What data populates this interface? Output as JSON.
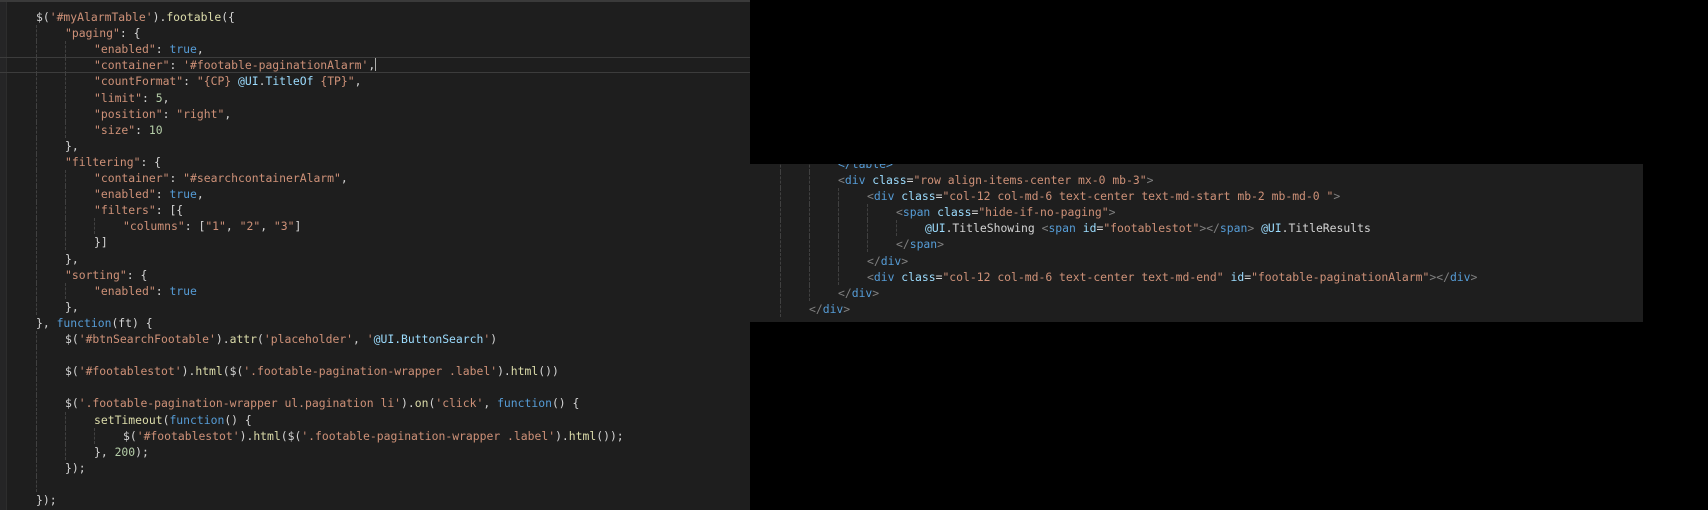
{
  "editor_left": {
    "language": "javascript",
    "lines": [
      {
        "indent": 0,
        "tokens": [
          [
            "plain",
            "$("
          ],
          [
            "string",
            "'#myAlarmTable'"
          ],
          [
            "plain",
            ")."
          ],
          [
            "method",
            "footable"
          ],
          [
            "plain",
            "({"
          ]
        ]
      },
      {
        "indent": 1,
        "tokens": [
          [
            "string",
            "\"paging\""
          ],
          [
            "plain",
            ": {"
          ]
        ]
      },
      {
        "indent": 2,
        "tokens": [
          [
            "string",
            "\"enabled\""
          ],
          [
            "plain",
            ": "
          ],
          [
            "keyword",
            "true"
          ],
          [
            "plain",
            ","
          ]
        ]
      },
      {
        "indent": 2,
        "current": true,
        "caret": true,
        "tokens": [
          [
            "string",
            "\"container\""
          ],
          [
            "plain",
            ": "
          ],
          [
            "string",
            "'#footable-paginationAlarm'"
          ],
          [
            "plain",
            ","
          ]
        ]
      },
      {
        "indent": 2,
        "tokens": [
          [
            "string",
            "\"countFormat\""
          ],
          [
            "plain",
            ": "
          ],
          [
            "string",
            "\"{CP} "
          ],
          [
            "razor",
            "@UI"
          ],
          [
            "plain",
            "."
          ],
          [
            "razor",
            "TitleOf"
          ],
          [
            "string",
            " {TP}\""
          ],
          [
            "plain",
            ","
          ]
        ]
      },
      {
        "indent": 2,
        "tokens": [
          [
            "string",
            "\"limit\""
          ],
          [
            "plain",
            ": "
          ],
          [
            "number",
            "5"
          ],
          [
            "plain",
            ","
          ]
        ]
      },
      {
        "indent": 2,
        "tokens": [
          [
            "string",
            "\"position\""
          ],
          [
            "plain",
            ": "
          ],
          [
            "string",
            "\"right\""
          ],
          [
            "plain",
            ","
          ]
        ]
      },
      {
        "indent": 2,
        "tokens": [
          [
            "string",
            "\"size\""
          ],
          [
            "plain",
            ": "
          ],
          [
            "number",
            "10"
          ]
        ]
      },
      {
        "indent": 1,
        "tokens": [
          [
            "plain",
            "},"
          ]
        ]
      },
      {
        "indent": 1,
        "tokens": [
          [
            "string",
            "\"filtering\""
          ],
          [
            "plain",
            ": {"
          ]
        ]
      },
      {
        "indent": 2,
        "tokens": [
          [
            "string",
            "\"container\""
          ],
          [
            "plain",
            ": "
          ],
          [
            "string",
            "\"#searchcontainerAlarm\""
          ],
          [
            "plain",
            ","
          ]
        ]
      },
      {
        "indent": 2,
        "tokens": [
          [
            "string",
            "\"enabled\""
          ],
          [
            "plain",
            ": "
          ],
          [
            "keyword",
            "true"
          ],
          [
            "plain",
            ","
          ]
        ]
      },
      {
        "indent": 2,
        "tokens": [
          [
            "string",
            "\"filters\""
          ],
          [
            "plain",
            ": [{"
          ]
        ]
      },
      {
        "indent": 3,
        "tokens": [
          [
            "string",
            "\"columns\""
          ],
          [
            "plain",
            ": ["
          ],
          [
            "string",
            "\"1\""
          ],
          [
            "plain",
            ", "
          ],
          [
            "string",
            "\"2\""
          ],
          [
            "plain",
            ", "
          ],
          [
            "string",
            "\"3\""
          ],
          [
            "plain",
            "]"
          ]
        ]
      },
      {
        "indent": 2,
        "tokens": [
          [
            "plain",
            "}]"
          ]
        ]
      },
      {
        "indent": 1,
        "tokens": [
          [
            "plain",
            "},"
          ]
        ]
      },
      {
        "indent": 1,
        "tokens": [
          [
            "string",
            "\"sorting\""
          ],
          [
            "plain",
            ": {"
          ]
        ]
      },
      {
        "indent": 2,
        "tokens": [
          [
            "string",
            "\"enabled\""
          ],
          [
            "plain",
            ": "
          ],
          [
            "keyword",
            "true"
          ]
        ]
      },
      {
        "indent": 1,
        "tokens": [
          [
            "plain",
            "},"
          ]
        ]
      },
      {
        "indent": 0,
        "tokens": [
          [
            "plain",
            "}, "
          ],
          [
            "keyword",
            "function"
          ],
          [
            "plain",
            "(ft) {"
          ]
        ]
      },
      {
        "indent": 1,
        "tokens": [
          [
            "plain",
            "$("
          ],
          [
            "string",
            "'#btnSearchFootable'"
          ],
          [
            "plain",
            ")."
          ],
          [
            "method",
            "attr"
          ],
          [
            "plain",
            "("
          ],
          [
            "string",
            "'placeholder'"
          ],
          [
            "plain",
            ", "
          ],
          [
            "string",
            "'"
          ],
          [
            "razor",
            "@UI.ButtonSearch"
          ],
          [
            "string",
            "'"
          ],
          [
            "plain",
            ")"
          ]
        ]
      },
      {
        "indent": 1,
        "guides": 1,
        "tokens": []
      },
      {
        "indent": 1,
        "tokens": [
          [
            "plain",
            "$("
          ],
          [
            "string",
            "'#footablestot'"
          ],
          [
            "plain",
            ")."
          ],
          [
            "method",
            "html"
          ],
          [
            "plain",
            "($("
          ],
          [
            "string",
            "'.footable-pagination-wrapper .label'"
          ],
          [
            "plain",
            ")."
          ],
          [
            "method",
            "html"
          ],
          [
            "plain",
            "())"
          ]
        ]
      },
      {
        "indent": 1,
        "guides": 1,
        "tokens": []
      },
      {
        "indent": 1,
        "tokens": [
          [
            "plain",
            "$("
          ],
          [
            "string",
            "'.footable-pagination-wrapper ul.pagination li'"
          ],
          [
            "plain",
            ")."
          ],
          [
            "method",
            "on"
          ],
          [
            "plain",
            "("
          ],
          [
            "string",
            "'click'"
          ],
          [
            "plain",
            ", "
          ],
          [
            "keyword",
            "function"
          ],
          [
            "plain",
            "() {"
          ]
        ]
      },
      {
        "indent": 2,
        "tokens": [
          [
            "method",
            "setTimeout"
          ],
          [
            "plain",
            "("
          ],
          [
            "keyword",
            "function"
          ],
          [
            "plain",
            "() {"
          ]
        ]
      },
      {
        "indent": 3,
        "tokens": [
          [
            "plain",
            "$("
          ],
          [
            "string",
            "'#footablestot'"
          ],
          [
            "plain",
            ")."
          ],
          [
            "method",
            "html"
          ],
          [
            "plain",
            "($("
          ],
          [
            "string",
            "'.footable-pagination-wrapper .label'"
          ],
          [
            "plain",
            ")."
          ],
          [
            "method",
            "html"
          ],
          [
            "plain",
            "());"
          ]
        ]
      },
      {
        "indent": 2,
        "tokens": [
          [
            "plain",
            "}, "
          ],
          [
            "number",
            "200"
          ],
          [
            "plain",
            ");"
          ]
        ]
      },
      {
        "indent": 1,
        "tokens": [
          [
            "plain",
            "});"
          ]
        ]
      },
      {
        "indent": 1,
        "guides": 1,
        "tokens": []
      },
      {
        "indent": 0,
        "tokens": [
          [
            "plain",
            "});"
          ]
        ]
      }
    ]
  },
  "editor_right": {
    "language": "html",
    "lines": [
      {
        "indent": 2,
        "clipped": true,
        "tokens": [
          [
            "tag",
            "</table>"
          ]
        ]
      },
      {
        "indent": 2,
        "tokens": [
          [
            "punct",
            "<"
          ],
          [
            "tag",
            "div"
          ],
          [
            "plain",
            " "
          ],
          [
            "attr",
            "class"
          ],
          [
            "plain",
            "="
          ],
          [
            "string",
            "\"row align-items-center mx-0 mb-3\""
          ],
          [
            "punct",
            ">"
          ]
        ]
      },
      {
        "indent": 3,
        "tokens": [
          [
            "punct",
            "<"
          ],
          [
            "tag",
            "div"
          ],
          [
            "plain",
            " "
          ],
          [
            "attr",
            "class"
          ],
          [
            "plain",
            "="
          ],
          [
            "string",
            "\"col-12 col-md-6 text-center text-md-start mb-2 mb-md-0 \""
          ],
          [
            "punct",
            ">"
          ]
        ]
      },
      {
        "indent": 4,
        "tokens": [
          [
            "punct",
            "<"
          ],
          [
            "tag",
            "span"
          ],
          [
            "plain",
            " "
          ],
          [
            "attr",
            "class"
          ],
          [
            "plain",
            "="
          ],
          [
            "string",
            "\"hide-if-no-paging\""
          ],
          [
            "punct",
            ">"
          ]
        ]
      },
      {
        "indent": 5,
        "tokens": [
          [
            "razor",
            "@UI"
          ],
          [
            "plain",
            ".TitleShowing "
          ],
          [
            "punct",
            "<"
          ],
          [
            "tag",
            "span"
          ],
          [
            "plain",
            " "
          ],
          [
            "attr",
            "id"
          ],
          [
            "plain",
            "="
          ],
          [
            "string",
            "\"footablestot\""
          ],
          [
            "punct",
            "></"
          ],
          [
            "tag",
            "span"
          ],
          [
            "punct",
            ">"
          ],
          [
            "plain",
            " "
          ],
          [
            "razor",
            "@UI"
          ],
          [
            "plain",
            ".TitleResults"
          ]
        ]
      },
      {
        "indent": 4,
        "tokens": [
          [
            "punct",
            "</"
          ],
          [
            "tag",
            "span"
          ],
          [
            "punct",
            ">"
          ]
        ]
      },
      {
        "indent": 3,
        "tokens": [
          [
            "punct",
            "</"
          ],
          [
            "tag",
            "div"
          ],
          [
            "punct",
            ">"
          ]
        ]
      },
      {
        "indent": 3,
        "tokens": [
          [
            "punct",
            "<"
          ],
          [
            "tag",
            "div"
          ],
          [
            "plain",
            " "
          ],
          [
            "attr",
            "class"
          ],
          [
            "plain",
            "="
          ],
          [
            "string",
            "\"col-12 col-md-6 text-center text-md-end\""
          ],
          [
            "plain",
            " "
          ],
          [
            "attr",
            "id"
          ],
          [
            "plain",
            "="
          ],
          [
            "string",
            "\"footable-paginationAlarm\""
          ],
          [
            "punct",
            "></"
          ],
          [
            "tag",
            "div"
          ],
          [
            "punct",
            ">"
          ]
        ]
      },
      {
        "indent": 2,
        "tokens": [
          [
            "punct",
            "</"
          ],
          [
            "tag",
            "div"
          ],
          [
            "punct",
            ">"
          ]
        ]
      },
      {
        "indent": 1,
        "tokens": [
          [
            "punct",
            "</"
          ],
          [
            "tag",
            "div"
          ],
          [
            "punct",
            ">"
          ]
        ]
      }
    ]
  },
  "colors": {
    "editor_background": "#1e1e1e",
    "screen_background": "#000000",
    "string": "#ce9178",
    "keyword": "#569cd6",
    "method": "#dcdcaa",
    "number": "#b5cea8",
    "razor": "#9cdcfe"
  }
}
